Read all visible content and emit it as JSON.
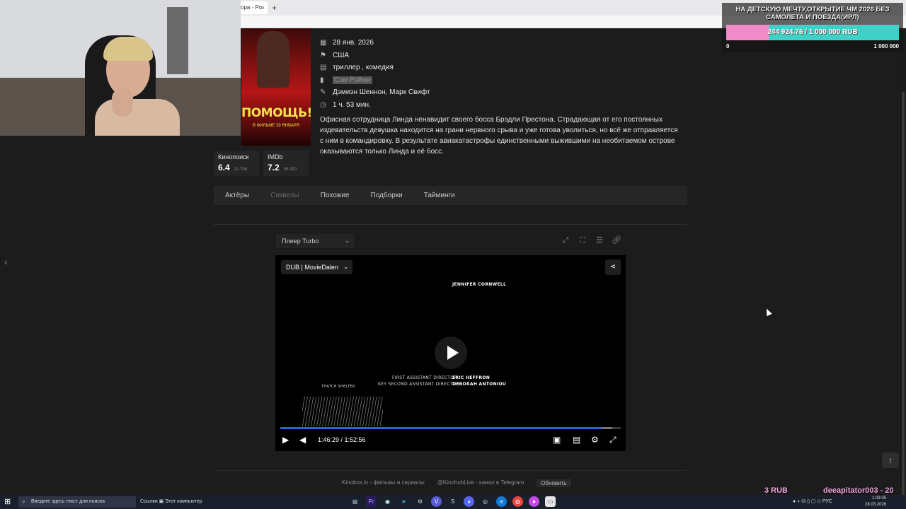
{
  "browser": {
    "tab_title": "ора - Ро",
    "tab_close": "×",
    "new_tab": "+"
  },
  "movie": {
    "poster_title": "ПОМОЩЬ!",
    "poster_subtitle": "В ФИЛЬМЕ 29 ЯНВАРЯ",
    "details": [
      {
        "icon": "calendar-icon",
        "glyph": "▦",
        "text": "28 янв. 2026"
      },
      {
        "icon": "flag-icon",
        "glyph": "⚑",
        "text": "США"
      },
      {
        "icon": "genre-icon",
        "glyph": "▤",
        "text": "триллер ,  комедия"
      },
      {
        "icon": "director-icon",
        "glyph": "▮",
        "text": "Сэм Рэйми"
      },
      {
        "icon": "pencil-icon",
        "glyph": "✎",
        "text": "Дэмиэн Шеннон, Марк Свифт"
      },
      {
        "icon": "clock-icon",
        "glyph": "◷",
        "text": "1 ч. 53 мин."
      }
    ],
    "description": "Офисная сотрудница Линда ненавидит своего босса Брэдли Престона. Страдающая от его постоянных издевательств девушка находится на грани нервного срыва и уже готова уволиться, но всё же отправляется с ним в командировку. В результате авиакатастрофы единственными выжившими на необитаемом острове оказываются только Линда и её босс."
  },
  "ratings": [
    {
      "name": "Кинопоиск",
      "value": "6.4",
      "count": "12 708"
    },
    {
      "name": "IMDb",
      "value": "7.2",
      "count": "35 000"
    }
  ],
  "tabs": [
    {
      "label": "Актёры",
      "disabled": false
    },
    {
      "label": "Сиквелы",
      "disabled": true
    },
    {
      "label": "Похожие",
      "disabled": false
    },
    {
      "label": "Подборки",
      "disabled": false
    },
    {
      "label": "Тайминги",
      "disabled": false
    }
  ],
  "player": {
    "select_value": "Плеер Turbo",
    "dub_value": "DUB | MovieDalen",
    "credit_top": "JENNIFER CORNWELL",
    "credit_role1": "FIRST ASSISTANT DIRECTOR",
    "credit_name1": "ERIC HEFFRON",
    "credit_role2": "KEY SECOND ASSISTANT DIRECTOR",
    "credit_name2": "DEBORAH ANTONIOU",
    "credit_left": "THATCH SHELTER",
    "time": "1:46:29 / 1:52:56",
    "progress": 0.943,
    "buffered": 0.975
  },
  "footer": {
    "link1": "Kinobox.in - фильмы и сериалы",
    "link2": "@KinohubLive - канал в Telegram",
    "refresh": "Обновить"
  },
  "donation": {
    "title": "НА ДЕТСКУЮ МЕЧТУ,ОТКРЫТИЕ ЧМ 2026 БЕЗ САМОЛЕТА И ПОЕЗДА(ИРЛ)",
    "amount": "244 924.76 / 1 000 000 RUB",
    "progress": 0.245,
    "min": "0",
    "max": "1 000 000",
    "fill_color": "#f08bc8",
    "track_color": "#3fd1c7"
  },
  "overlay": {
    "rub": "3 RUB",
    "user": "deeapitator003 - 20"
  },
  "taskbar": {
    "search_placeholder": "Введите здесь текст для поиска",
    "links": "Ссылки",
    "computer": "Этот компьютер",
    "lang": "РУС",
    "time": "1:09:05",
    "date": "28.03.2026"
  }
}
